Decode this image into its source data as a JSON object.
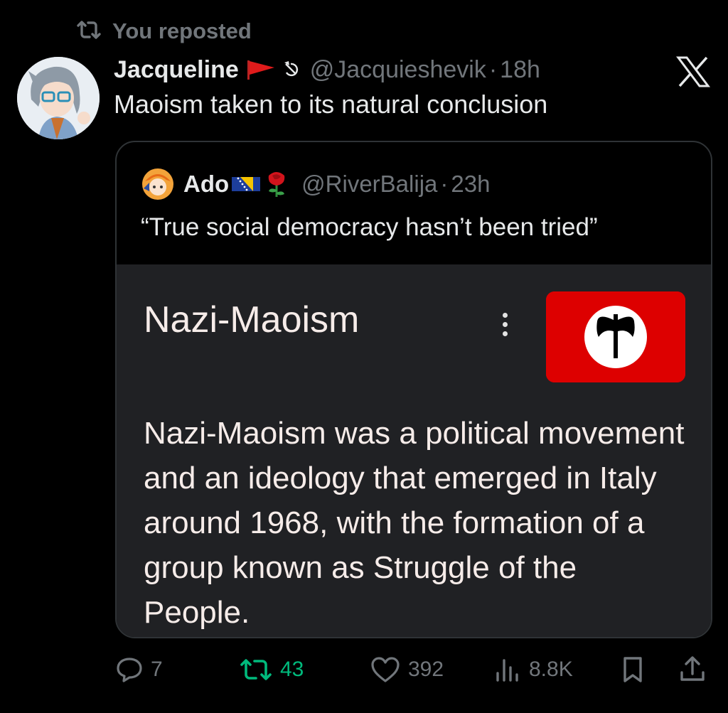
{
  "repost": {
    "icon": "repost-icon",
    "label": "You reposted"
  },
  "post": {
    "author_name": "Jacqueline",
    "author_badges": [
      "🚩",
      "☭"
    ],
    "handle": "@Jacquieshevik",
    "dot": "·",
    "time": "18h",
    "text": "Maoism taken to its natural conclusion",
    "avatar": "avatar-image"
  },
  "quote": {
    "author_name": "Ado",
    "author_badges": [
      "🌹"
    ],
    "handle": "@RiverBalija",
    "dot": "·",
    "time": "23h",
    "text": "“True social democracy hasn’t been tried”",
    "media": {
      "title": "Nazi-Maoism",
      "description": "Nazi-Maoism was a political movement and an ideology that emerged in Italy around 1968, with the formation of a group known as Struggle of the People."
    }
  },
  "actions": {
    "replies": "7",
    "reposts": "43",
    "likes": "392",
    "views": "8.8K"
  },
  "colors": {
    "background": "#000000",
    "text": "#e7e9ea",
    "muted": "#71767b",
    "repost_active": "#00ba7c",
    "border": "#2f3336",
    "card_bg": "#202124",
    "flag_red": "#dd0000"
  }
}
